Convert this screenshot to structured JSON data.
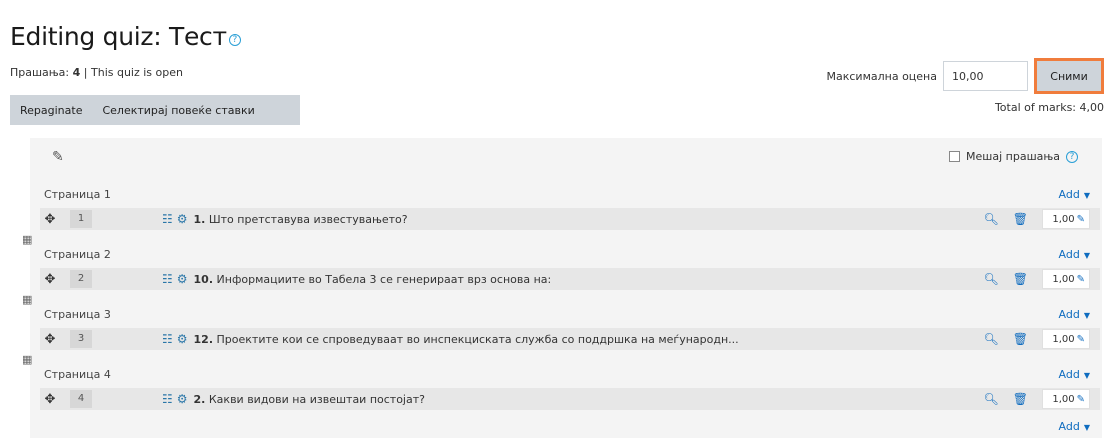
{
  "header": {
    "title": "Editing quiz: Тест",
    "help_icon": "?"
  },
  "status": {
    "questions_label": "Прашања:",
    "questions_count": "4",
    "separator": " | ",
    "quiz_state": "This quiz is open"
  },
  "toolbar": {
    "repaginate": "Repaginate",
    "select_multiple": "Селектирај повеќе ставки"
  },
  "grade": {
    "label": "Максимална оцена",
    "value": "10,00",
    "save": "Сними",
    "total": "Total of marks: 4,00"
  },
  "panel": {
    "shuffle_label": "Мешај прашања",
    "add_label": "Add"
  },
  "pages": [
    {
      "label": "Страница 1",
      "question": {
        "num": "1",
        "prefix": "1.",
        "text": " Што претставува известувањето?",
        "mark": "1,00"
      }
    },
    {
      "label": "Страница 2",
      "question": {
        "num": "2",
        "prefix": "10.",
        "text": " Информациите во Табела 3 се генерираат врз основа на:",
        "mark": "1,00"
      }
    },
    {
      "label": "Страница 3",
      "question": {
        "num": "3",
        "prefix": "12.",
        "text": " Проектите кои се спроведуваат во инспекциската служба со поддршка на меѓународн...",
        "mark": "1,00"
      }
    },
    {
      "label": "Страница 4",
      "question": {
        "num": "4",
        "prefix": "2.",
        "text": " Какви видови на извештаи постојат?",
        "mark": "1,00"
      }
    }
  ],
  "colors": {
    "accent": "#0f6cbf",
    "highlight_border": "#f07c3c",
    "button_bg": "#ced4da",
    "panel_bg": "#f4f4f4"
  }
}
